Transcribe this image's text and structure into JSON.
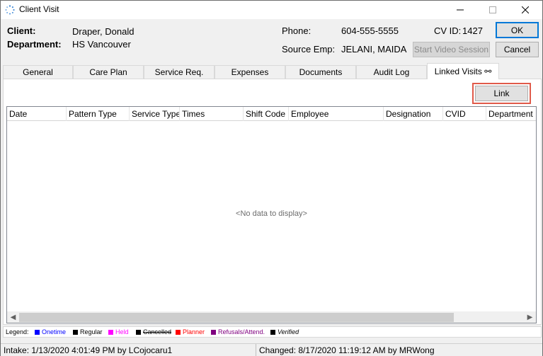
{
  "window": {
    "title": "Client Visit"
  },
  "header": {
    "client_label": "Client:",
    "client_value": "Draper, Donald",
    "department_label": "Department:",
    "department_value": "HS Vancouver",
    "phone_label": "Phone:",
    "phone_value": "604-555-5555",
    "cvid_label": "CV ID:",
    "cvid_value": "1427",
    "source_emp_label": "Source Emp:",
    "source_emp_value": "JELANI, MAIDA",
    "start_video_label": "Start Video Session",
    "ok_label": "OK",
    "cancel_label": "Cancel"
  },
  "tabs": [
    {
      "label": "General"
    },
    {
      "label": "Care Plan"
    },
    {
      "label": "Service Req."
    },
    {
      "label": "Expenses"
    },
    {
      "label": "Documents"
    },
    {
      "label": "Audit Log"
    },
    {
      "label": "Linked Visits ⚯"
    }
  ],
  "active_tab": "Linked Visits",
  "panel": {
    "link_label": "Link",
    "columns": [
      "Date",
      "Pattern Type",
      "Service Type",
      "Times",
      "Shift Code",
      "Employee",
      "Designation",
      "CVID",
      "Department"
    ],
    "no_data": "<No data to display>"
  },
  "legend": {
    "title": "Legend:",
    "items": [
      {
        "label": "Onetime",
        "color": "#0000ff"
      },
      {
        "label": "Regular",
        "color": "#000000"
      },
      {
        "label": "Held",
        "color": "#ff00ff"
      },
      {
        "label": "Cancelled",
        "color": "#000000"
      },
      {
        "label": "Planner",
        "color": "#ff0000"
      },
      {
        "label": "Refusals/Attend.",
        "color": "#800080"
      },
      {
        "label": "Verified",
        "color": "#000000"
      }
    ]
  },
  "status": {
    "intake": "Intake: 1/13/2020 4:01:49 PM by LCojocaru1",
    "changed": "Changed: 8/17/2020 11:19:12 AM by MRWong"
  }
}
